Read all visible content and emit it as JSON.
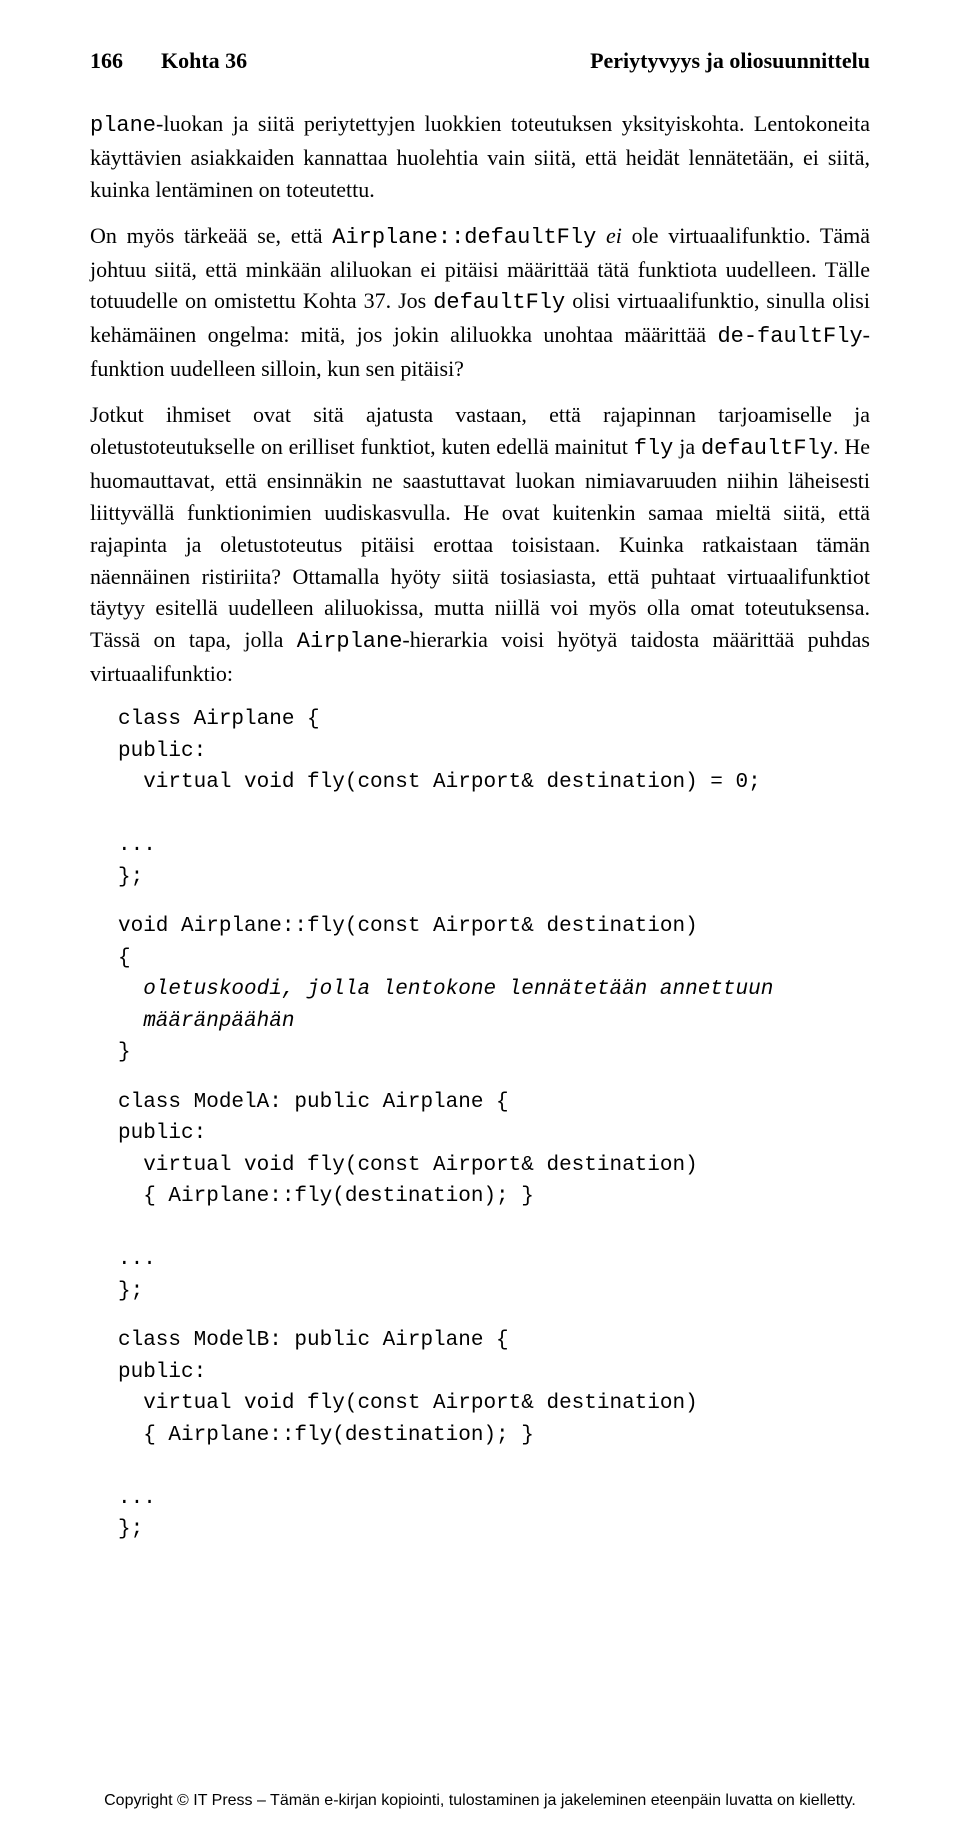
{
  "header": {
    "pageNum": "166",
    "section": "Kohta 36",
    "chapter": "Periytyvyys ja oliosuunnittelu"
  },
  "p1": {
    "t1": "plane",
    "t2": "-luokan ja siitä periytettyjen luokkien toteutuksen yksityiskohta. Lentokoneita käyttävien asiakkaiden kannattaa huolehtia vain siitä, että heidät lennätetään, ei siitä, kuinka lentäminen on toteutettu."
  },
  "p2": {
    "t1": "On myös tärkeää se, että ",
    "t2": "Airplane::defaultFly",
    "t3": " ei",
    "t4": " ole virtuaalifunktio. Tämä johtuu siitä, että minkään aliluokan ei pitäisi määrittää tätä funktiota uudelleen. Tälle totuudelle on omistettu Kohta 37. Jos ",
    "t5": "defaultFly",
    "t6": " olisi virtuaalifunktio, sinulla olisi kehämäinen ongelma: mitä, jos jokin aliluokka unohtaa määrittää ",
    "t7": "de-faultFly",
    "t8": "-funktion uudelleen silloin, kun sen pitäisi?"
  },
  "p3": {
    "t1": "Jotkut ihmiset ovat sitä ajatusta vastaan, että rajapinnan tarjoamiselle ja oletustoteutukselle on erilliset funktiot, kuten edellä mainitut ",
    "t2": "fly",
    "t3": " ja ",
    "t4": "defaultFly",
    "t5": ". He huomauttavat, että ensinnäkin ne saastuttavat luokan nimiavaruuden niihin läheisesti liittyvällä funktionimien uudiskasvulla. He ovat kuitenkin samaa mieltä siitä, että rajapinta ja oletustoteutus pitäisi erottaa toisistaan. Kuinka ratkaistaan tämän näennäinen ristiriita? Ottamalla hyöty siitä tosiasiasta, että puhtaat virtuaalifunktiot täytyy esitellä uudelleen aliluokissa, mutta niillä voi myös olla omat toteutuksensa. Tässä on tapa, jolla ",
    "t6": "Airplane",
    "t7": "-hierarkia voisi hyötyä taidosta määrittää puhdas virtuaalifunktio:"
  },
  "code1": {
    "l1": "class Airplane {",
    "l2": "public:",
    "l3": "  virtual void fly(const Airport& destination) = 0;",
    "l4": "...",
    "l5": "};"
  },
  "code2": {
    "l1": "void Airplane::fly(const Airport& destination)",
    "l2": "{",
    "l3a": "  oletuskoodi, jolla lentokone lennätetään annettuun",
    "l3b": "  määränpäähän",
    "l4": "}"
  },
  "code3": {
    "l1": "class ModelA: public Airplane {",
    "l2": "public:",
    "l3": "  virtual void fly(const Airport& destination)",
    "l4": "  { Airplane::fly(destination); }",
    "l5": "...",
    "l6": "};"
  },
  "code4": {
    "l1": "class ModelB: public Airplane {",
    "l2": "public:",
    "l3": "  virtual void fly(const Airport& destination)",
    "l4": "  { Airplane::fly(destination); }",
    "l5": "...",
    "l6": "};"
  },
  "footer": "Copyright © IT Press – Tämän e-kirjan kopiointi, tulostaminen ja jakeleminen eteenpäin luvatta on kielletty."
}
